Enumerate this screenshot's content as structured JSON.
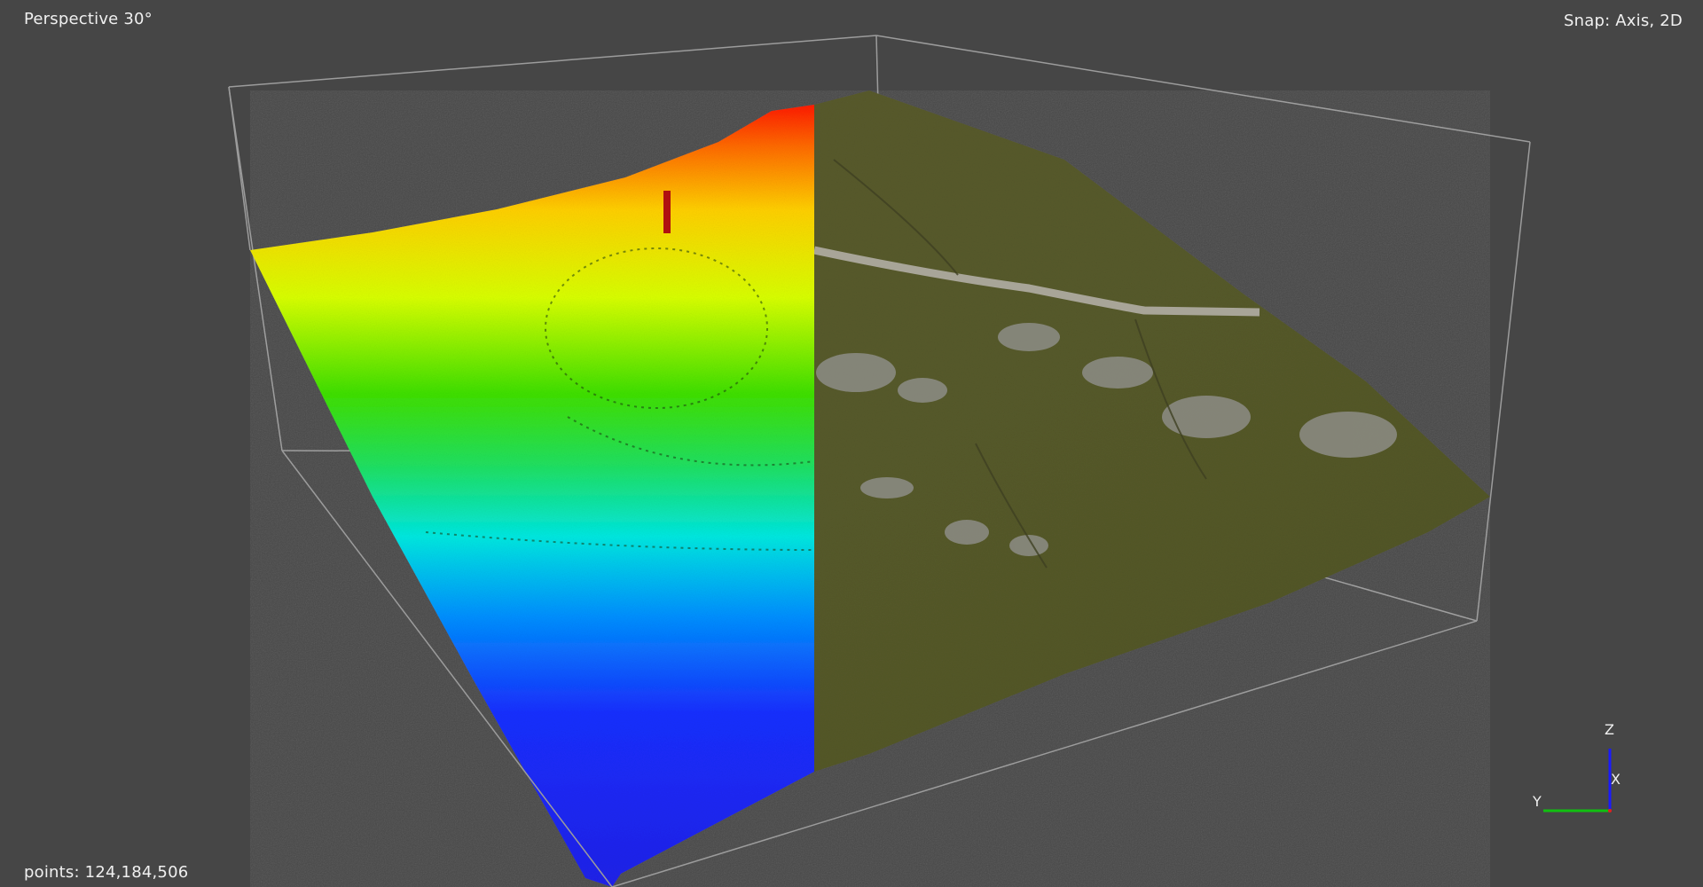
{
  "viewport": {
    "projection_label": "Perspective 30°",
    "snap_label": "Snap: Axis, 2D",
    "points_label": "points: 124,184,506"
  },
  "axis_gizmo": {
    "z_label": "Z",
    "x_label": "X",
    "y_label": "Y",
    "z_color": "#1a1aff",
    "x_color": "#e02020",
    "y_color": "#10c010"
  },
  "colors": {
    "background": "#464646",
    "bounding_box": "#a8a8a8",
    "elevation_ramp": [
      "#0000ff",
      "#00e0ff",
      "#00d000",
      "#ffff00",
      "#ff0000"
    ],
    "terrain_grass": "#55552b"
  },
  "icons": {
    "scene": "point-cloud-render",
    "gizmo": "axis-triad-icon"
  }
}
